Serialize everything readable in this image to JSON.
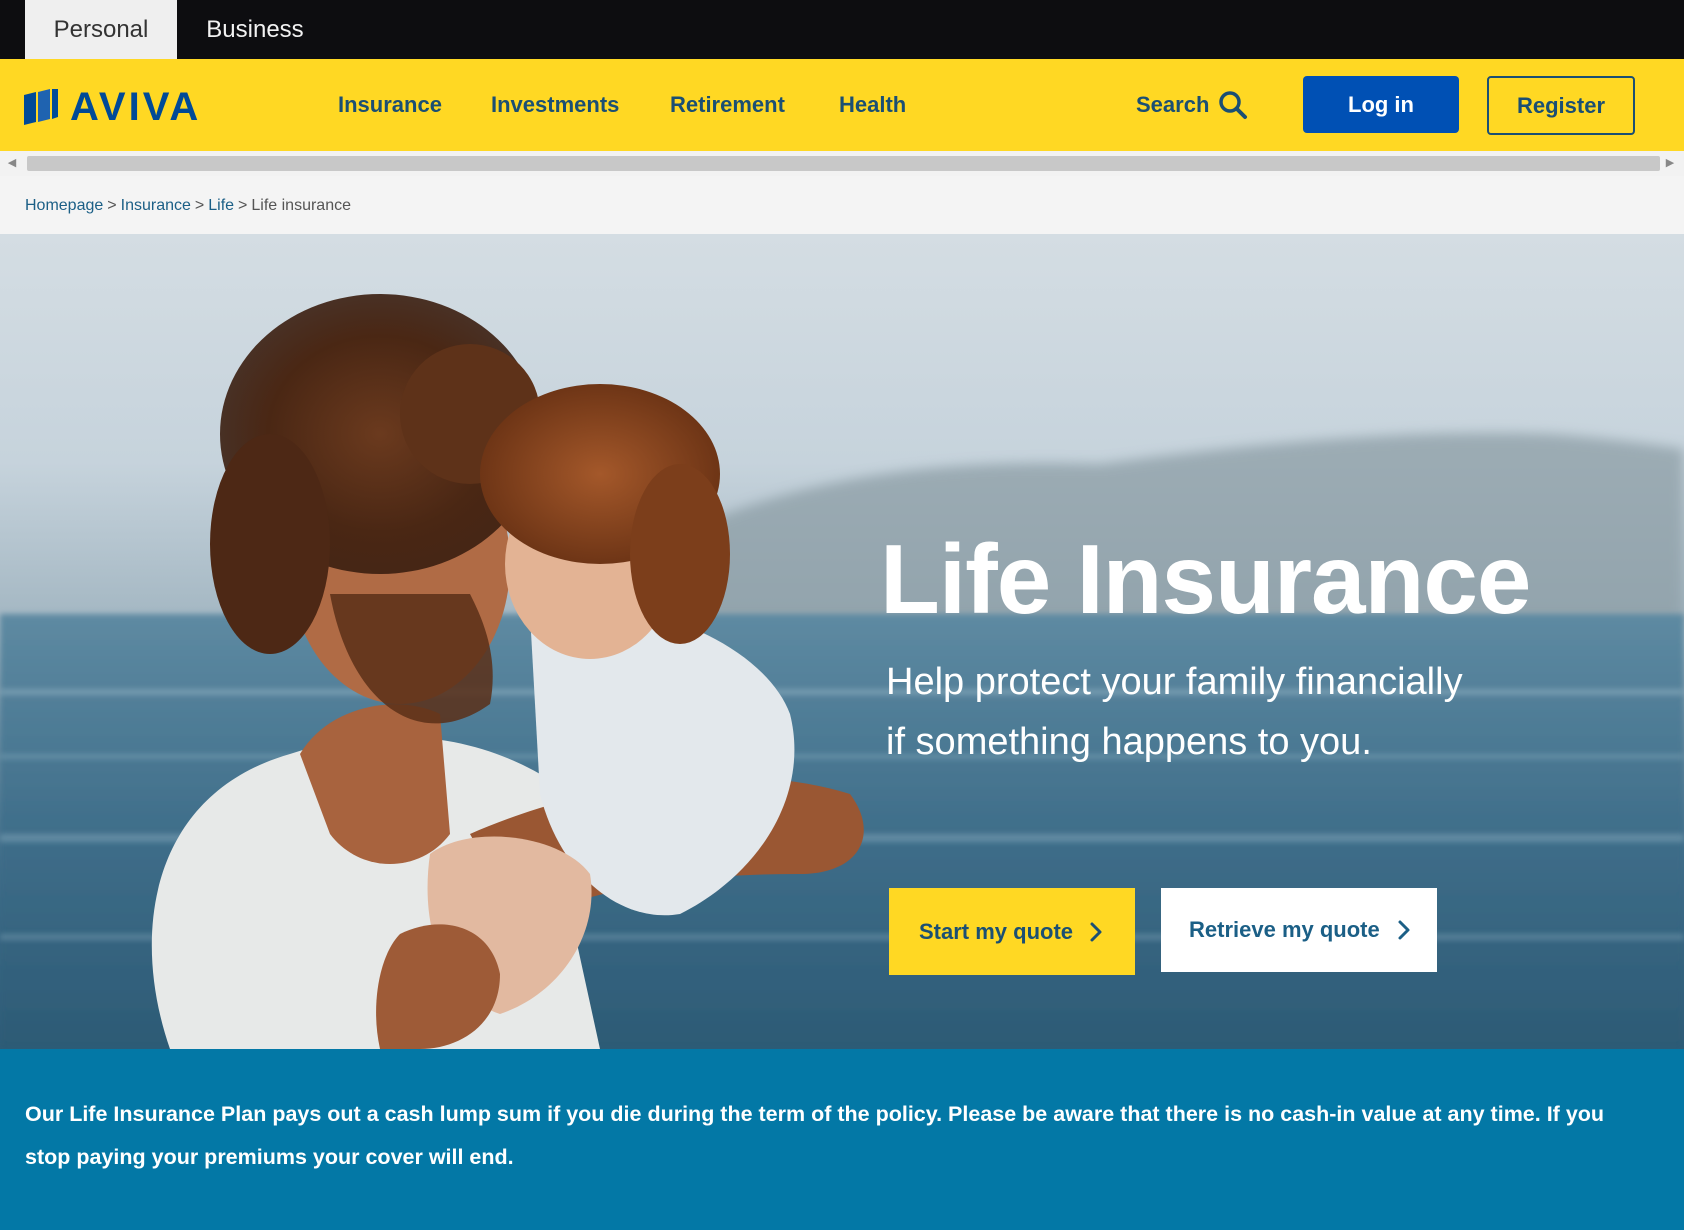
{
  "audience_tabs": {
    "personal": "Personal",
    "business": "Business"
  },
  "header": {
    "logo_text": "AVIVA",
    "nav": {
      "insurance": "Insurance",
      "investments": "Investments",
      "retirement": "Retirement",
      "health": "Health"
    },
    "search_label": "Search",
    "login_label": "Log in",
    "register_label": "Register"
  },
  "breadcrumb": {
    "homepage": "Homepage",
    "insurance": "Insurance",
    "life": "Life",
    "current": "Life insurance",
    "separator": ">"
  },
  "hero": {
    "title": "Life Insurance",
    "subtitle": "Help protect your family financially if something happens to you.",
    "start_quote_label": "Start my quote",
    "retrieve_quote_label": "Retrieve my quote"
  },
  "info": {
    "text": "Our Life Insurance Plan pays out a cash lump sum if you die during the term of the policy. Please be aware that there is no cash-in value at any time. If you stop paying your premiums your cover will end."
  },
  "colors": {
    "brand_yellow": "#ffd823",
    "brand_blue": "#004a97",
    "login_blue": "#0050b4",
    "nav_text": "#1b4f73",
    "info_strip": "#0378a6",
    "top_bar": "#0d0d10"
  },
  "icons": {
    "search": "search-icon",
    "chevron": "chevron-right-icon",
    "logo": "aviva-logo-mark"
  }
}
